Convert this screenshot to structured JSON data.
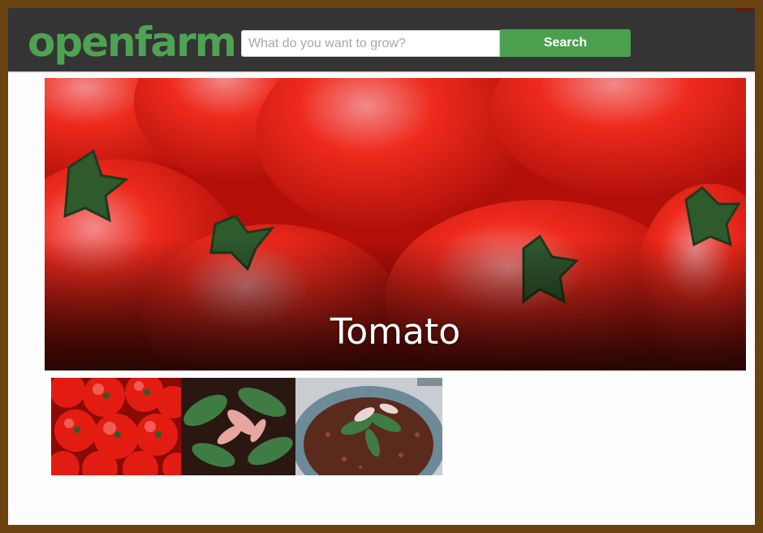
{
  "header": {
    "logo_text": "openfarm",
    "search": {
      "placeholder": "What do you want to grow?",
      "value": "",
      "button_label": "Search"
    }
  },
  "crop": {
    "name": "Tomato",
    "hero_image": "tomato-hero-photo",
    "gallery": [
      {
        "name": "tomato-pile-photo"
      },
      {
        "name": "seedling-leaves-photo"
      },
      {
        "name": "potted-seedling-photo"
      }
    ]
  },
  "colors": {
    "brand_green": "#4fa253",
    "button_green": "#4c9f4f",
    "header_bg": "#343434",
    "page_border": "#6b4212"
  }
}
